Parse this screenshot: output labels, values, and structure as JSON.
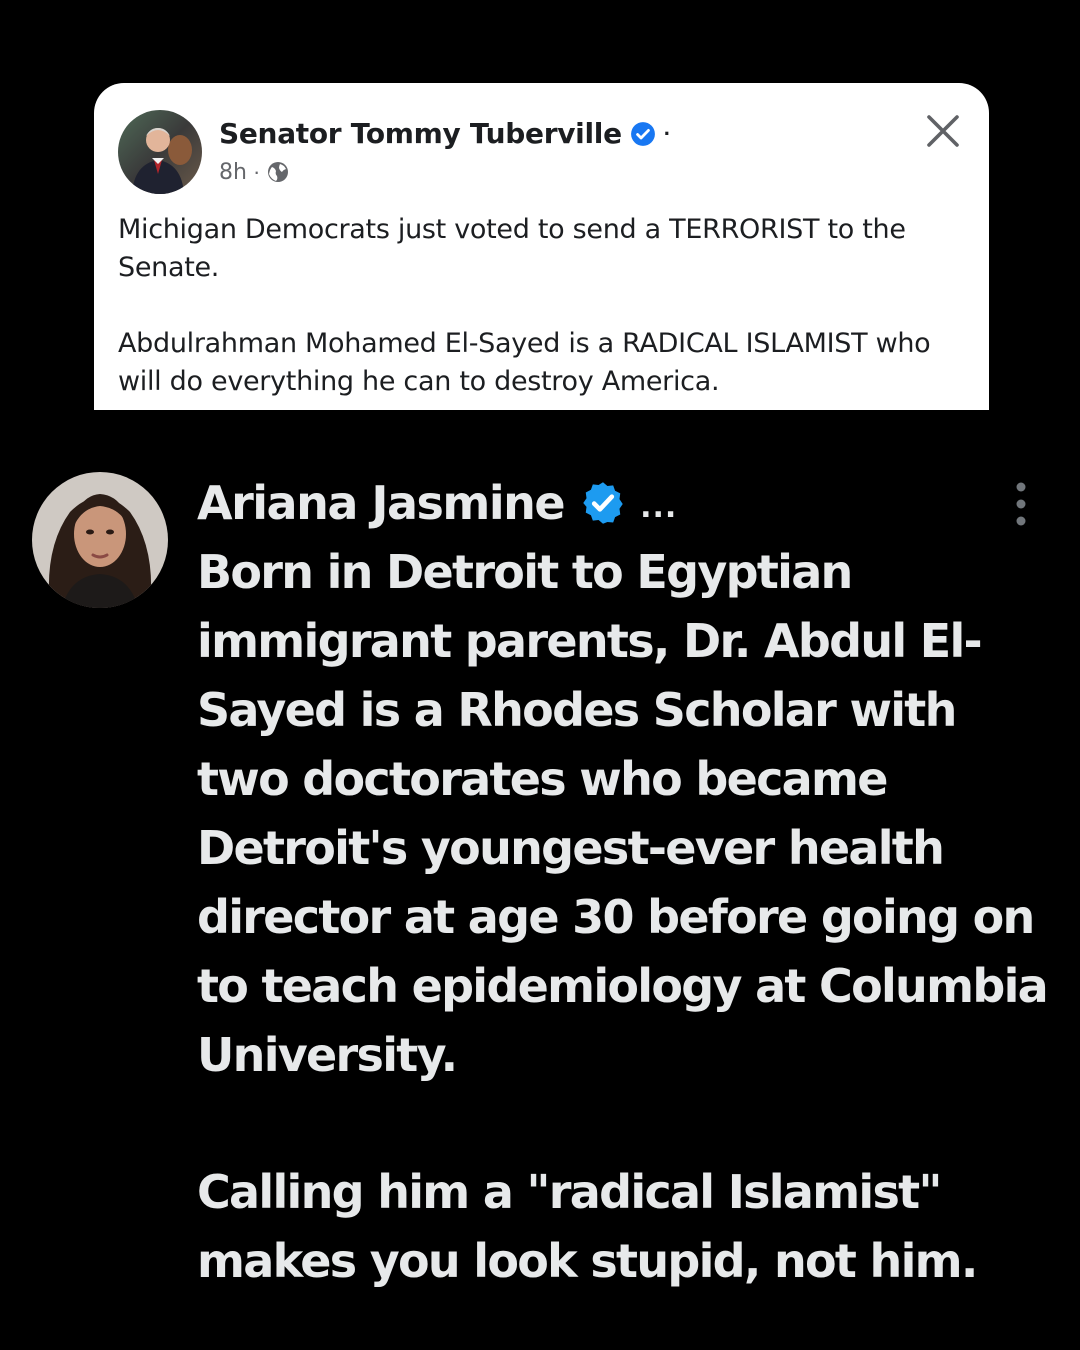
{
  "fb_post": {
    "author": "Senator Tommy Tuberville",
    "name_separator": "·",
    "time": "8h",
    "meta_separator": "·",
    "verified_icon": "verified-badge-icon",
    "audience_icon": "globe-icon",
    "close_icon": "close-icon",
    "paragraphs": [
      "Michigan Democrats just voted to send a TERRORIST to the Senate.",
      "Abdulrahman Mohamed El-Sayed is a RADICAL ISLAMIST who will do everything he can to destroy America."
    ]
  },
  "x_reply": {
    "author": "Ariana Jasmine",
    "ellipsis": "...",
    "verified_icon": "verified-badge-icon",
    "more_icon": "more-vertical-icon",
    "paragraphs": [
      "Born in Detroit to Egyptian immigrant parents, Dr. Abdul El-Sayed is a Rhodes Scholar with two doctorates who became Detroit's youngest-ever health director at age 30 before going on to teach epidemiology at Columbia University.",
      "Calling him a \"radical Islamist\" makes you look stupid, not him."
    ]
  },
  "colors": {
    "page_background": "#000000",
    "card_background": "#ffffff",
    "fb_text": "#1c1e21",
    "fb_meta": "#65676b",
    "verified_blue": "#1877f2",
    "x_verified_blue": "#1d9bf0",
    "x_text": "#e7e9ea"
  }
}
